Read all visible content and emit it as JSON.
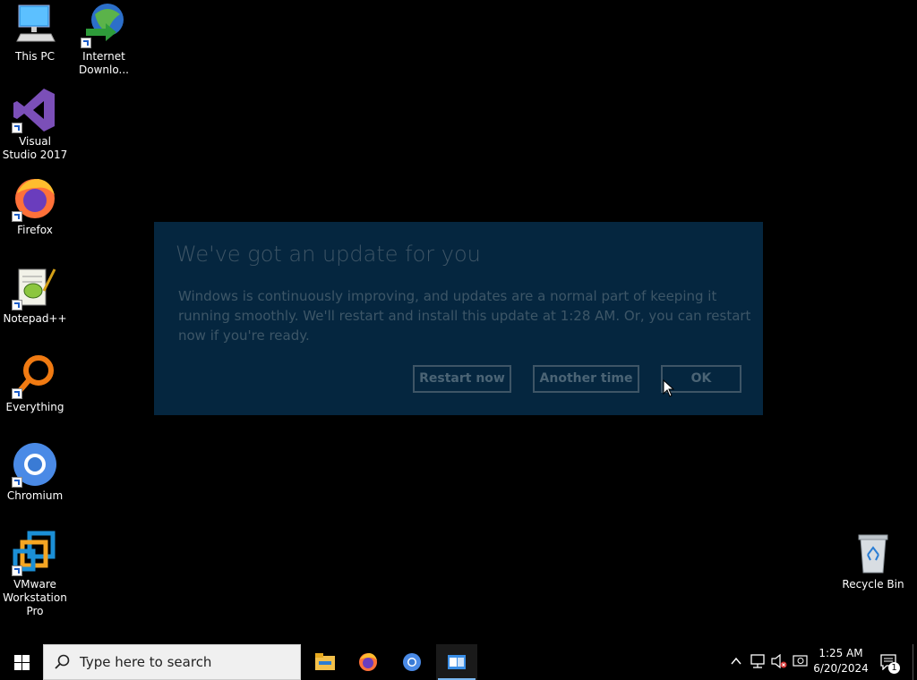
{
  "desktop": {
    "icons": [
      {
        "label": "This PC"
      },
      {
        "label": "Internet Downlo..."
      },
      {
        "label": "Visual Studio 2017"
      },
      {
        "label": "Firefox"
      },
      {
        "label": "Notepad++"
      },
      {
        "label": "Everything"
      },
      {
        "label": "Chromium"
      },
      {
        "label": "VMware Workstation Pro"
      },
      {
        "label": "Recycle Bin"
      }
    ]
  },
  "dialog": {
    "title": "We've got an update for you",
    "body": "Windows is continuously improving, and updates are a normal part of keeping it running smoothly. We'll restart and install this update at 1:28 AM. Or, you can restart now if you're ready.",
    "buttons": {
      "restart": "Restart now",
      "another": "Another time",
      "ok": "OK"
    }
  },
  "taskbar": {
    "search_placeholder": "Type here to search",
    "time": "1:25 AM",
    "date": "6/20/2024",
    "notification_count": "1"
  }
}
